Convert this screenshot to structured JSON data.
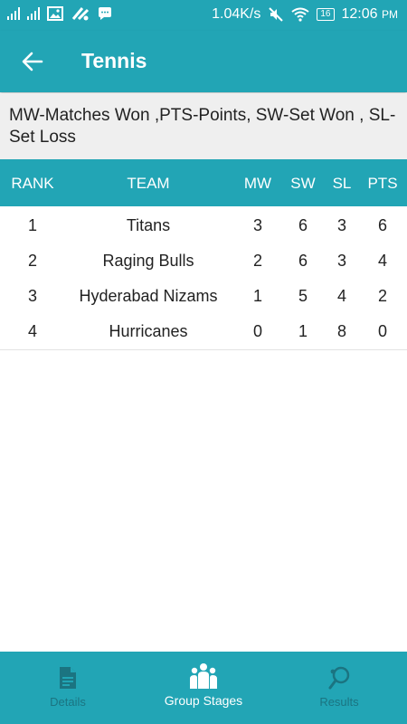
{
  "status_bar": {
    "speed": "1.04K/s",
    "battery": "16",
    "time": "12:06",
    "ampm": "PM"
  },
  "app_bar": {
    "title": "Tennis"
  },
  "legend_text": "MW-Matches Won ,PTS-Points, SW-Set Won , SL-Set Loss",
  "table": {
    "headers": {
      "rank": "RANK",
      "team": "TEAM",
      "mw": "MW",
      "sw": "SW",
      "sl": "SL",
      "pts": "PTS"
    },
    "rows": [
      {
        "rank": "1",
        "team": "Titans",
        "mw": "3",
        "sw": "6",
        "sl": "3",
        "pts": "6"
      },
      {
        "rank": "2",
        "team": "Raging Bulls",
        "mw": "2",
        "sw": "6",
        "sl": "3",
        "pts": "4"
      },
      {
        "rank": "3",
        "team": "Hyderabad Nizams",
        "mw": "1",
        "sw": "5",
        "sl": "4",
        "pts": "2"
      },
      {
        "rank": "4",
        "team": "Hurricanes",
        "mw": "0",
        "sw": "1",
        "sl": "8",
        "pts": "0"
      }
    ]
  },
  "bottom_nav": {
    "items": [
      {
        "label": "Details",
        "icon": "document-icon",
        "active": false
      },
      {
        "label": "Group Stages",
        "icon": "group-icon",
        "active": true
      },
      {
        "label": "Results",
        "icon": "tennis-racket-icon",
        "active": false
      }
    ]
  },
  "colors": {
    "primary": "#22a5b5",
    "inactive_nav": "#1b7481",
    "legend_bg": "#efefef"
  }
}
